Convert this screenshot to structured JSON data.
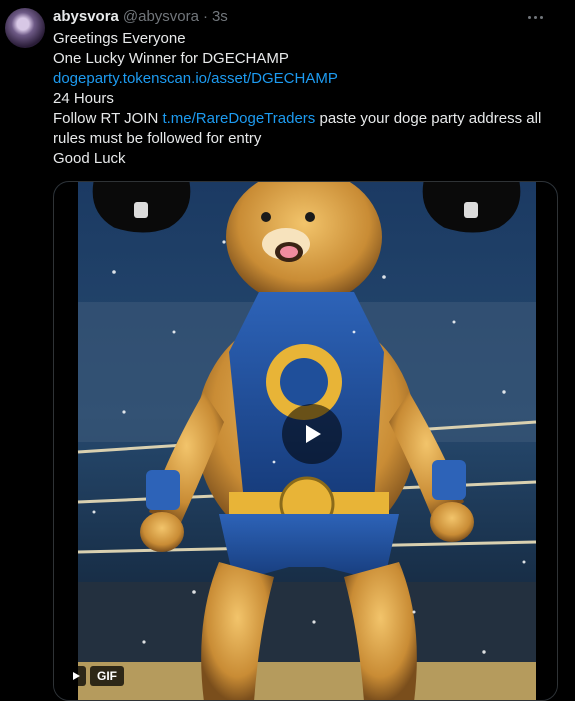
{
  "author": {
    "name": "abysvora",
    "handle": "@abysvora",
    "separator": "·",
    "time": "3s"
  },
  "menu_icon": "more-horizontal-icon",
  "text": {
    "line1": "Greetings Everyone",
    "line2": "One Lucky Winner for DGECHAMP",
    "link1": "dogeparty.tokenscan.io/asset/DGECHAMP",
    "line4": "24 Hours",
    "line5_prefix": "Follow RT JOIN ",
    "link2": "t.me/RareDogeTraders",
    "line5_suffix": " paste your doge party address all rules must be followed for entry",
    "line6": "Good Luck"
  },
  "media": {
    "type": "gif",
    "badge": "GIF",
    "play_icon": "play-icon"
  },
  "colors": {
    "background": "#000000",
    "text": "#e7e9ea",
    "secondary": "#71767b",
    "link": "#1d9bf0"
  }
}
